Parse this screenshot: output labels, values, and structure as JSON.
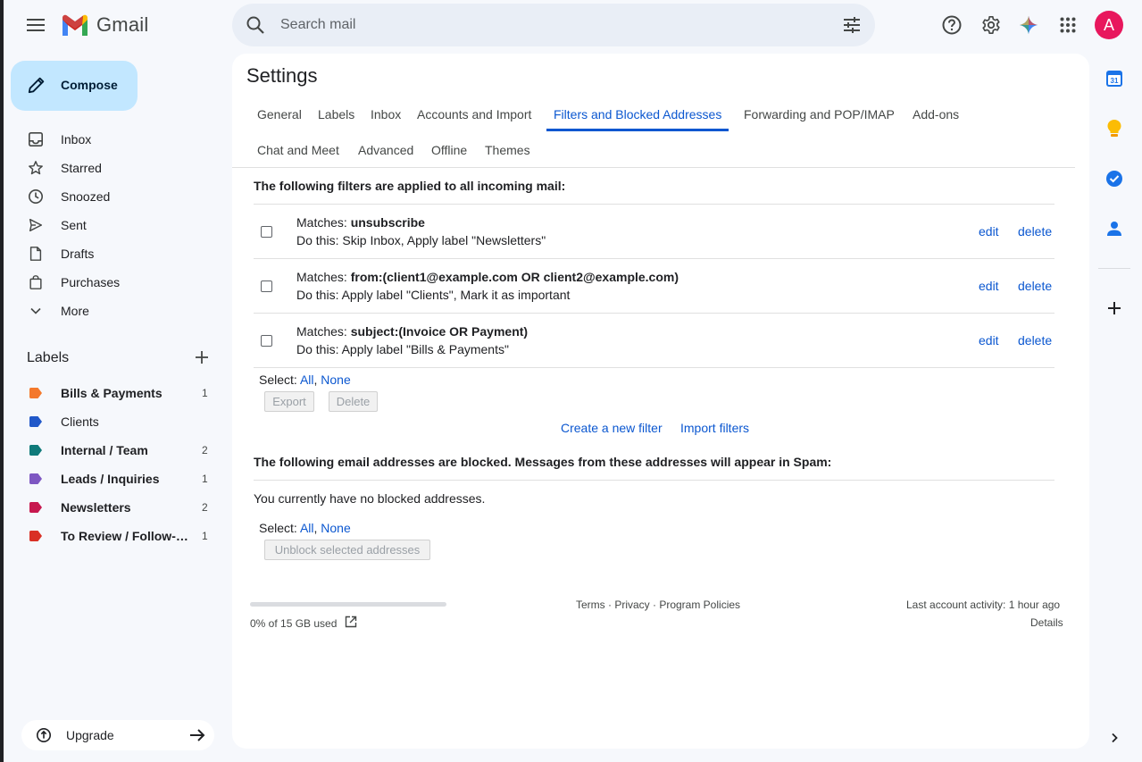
{
  "app": {
    "name": "Gmail"
  },
  "search": {
    "placeholder": "Search mail"
  },
  "compose": {
    "label": "Compose"
  },
  "nav": [
    {
      "label": "Inbox",
      "icon": "inbox-icon"
    },
    {
      "label": "Starred",
      "icon": "star-icon"
    },
    {
      "label": "Snoozed",
      "icon": "clock-icon"
    },
    {
      "label": "Sent",
      "icon": "send-icon"
    },
    {
      "label": "Drafts",
      "icon": "draft-icon"
    },
    {
      "label": "Purchases",
      "icon": "shopping-bag-icon"
    },
    {
      "label": "More",
      "icon": "chevron-down-icon"
    }
  ],
  "labels": {
    "heading": "Labels",
    "items": [
      {
        "name": "Bills & Payments",
        "count": "1",
        "color": "#f4792b",
        "bold": true
      },
      {
        "name": "Clients",
        "count": "",
        "color": "#2158c9",
        "bold": false
      },
      {
        "name": "Internal / Team",
        "count": "2",
        "color": "#0f7a7a",
        "bold": true
      },
      {
        "name": "Leads / Inquiries",
        "count": "1",
        "color": "#7e57c2",
        "bold": true
      },
      {
        "name": "Newsletters",
        "count": "2",
        "color": "#c7184f",
        "bold": true
      },
      {
        "name": "To Review / Follow-up",
        "count": "1",
        "color": "#d93025",
        "bold": true
      }
    ]
  },
  "upgrade": {
    "label": "Upgrade"
  },
  "settings": {
    "title": "Settings",
    "tabs_row1": [
      "General",
      "Labels",
      "Inbox",
      "Accounts and Import",
      "Filters and Blocked Addresses",
      "Forwarding and POP/IMAP",
      "Add-ons"
    ],
    "tabs_row2": [
      "Chat and Meet",
      "Advanced",
      "Offline",
      "Themes"
    ],
    "active_tab": "Filters and Blocked Addresses"
  },
  "filters": {
    "heading": "The following filters are applied to all incoming mail:",
    "matches_prefix": "Matches:",
    "action_prefix": "Do this:",
    "edit_label": "edit",
    "delete_label": "delete",
    "items": [
      {
        "match": "unsubscribe",
        "action": "Skip Inbox, Apply label \"Newsletters\""
      },
      {
        "match": "from:(client1@example.com OR client2@example.com)",
        "action": "Apply label \"Clients\", Mark it as important"
      },
      {
        "match": "subject:(Invoice OR Payment)",
        "action": "Apply label \"Bills & Payments\""
      }
    ],
    "select_prefix": "Select:",
    "select_all": "All",
    "select_none": "None",
    "export_label": "Export",
    "delete_button_label": "Delete",
    "create_filter_label": "Create a new filter",
    "import_filters_label": "Import filters"
  },
  "blocked": {
    "heading": "The following email addresses are blocked. Messages from these addresses will appear in Spam:",
    "empty_text": "You currently have no blocked addresses.",
    "select_prefix": "Select:",
    "select_all": "All",
    "select_none": "None",
    "unblock_label": "Unblock selected addresses"
  },
  "footer": {
    "storage_text": "0% of 15 GB used",
    "storage_percent": 0,
    "links": "Terms · Privacy · Program Policies",
    "activity": "Last account activity: 1 hour ago",
    "details": "Details"
  },
  "avatar": {
    "initial": "A",
    "color": "#e8175d"
  }
}
